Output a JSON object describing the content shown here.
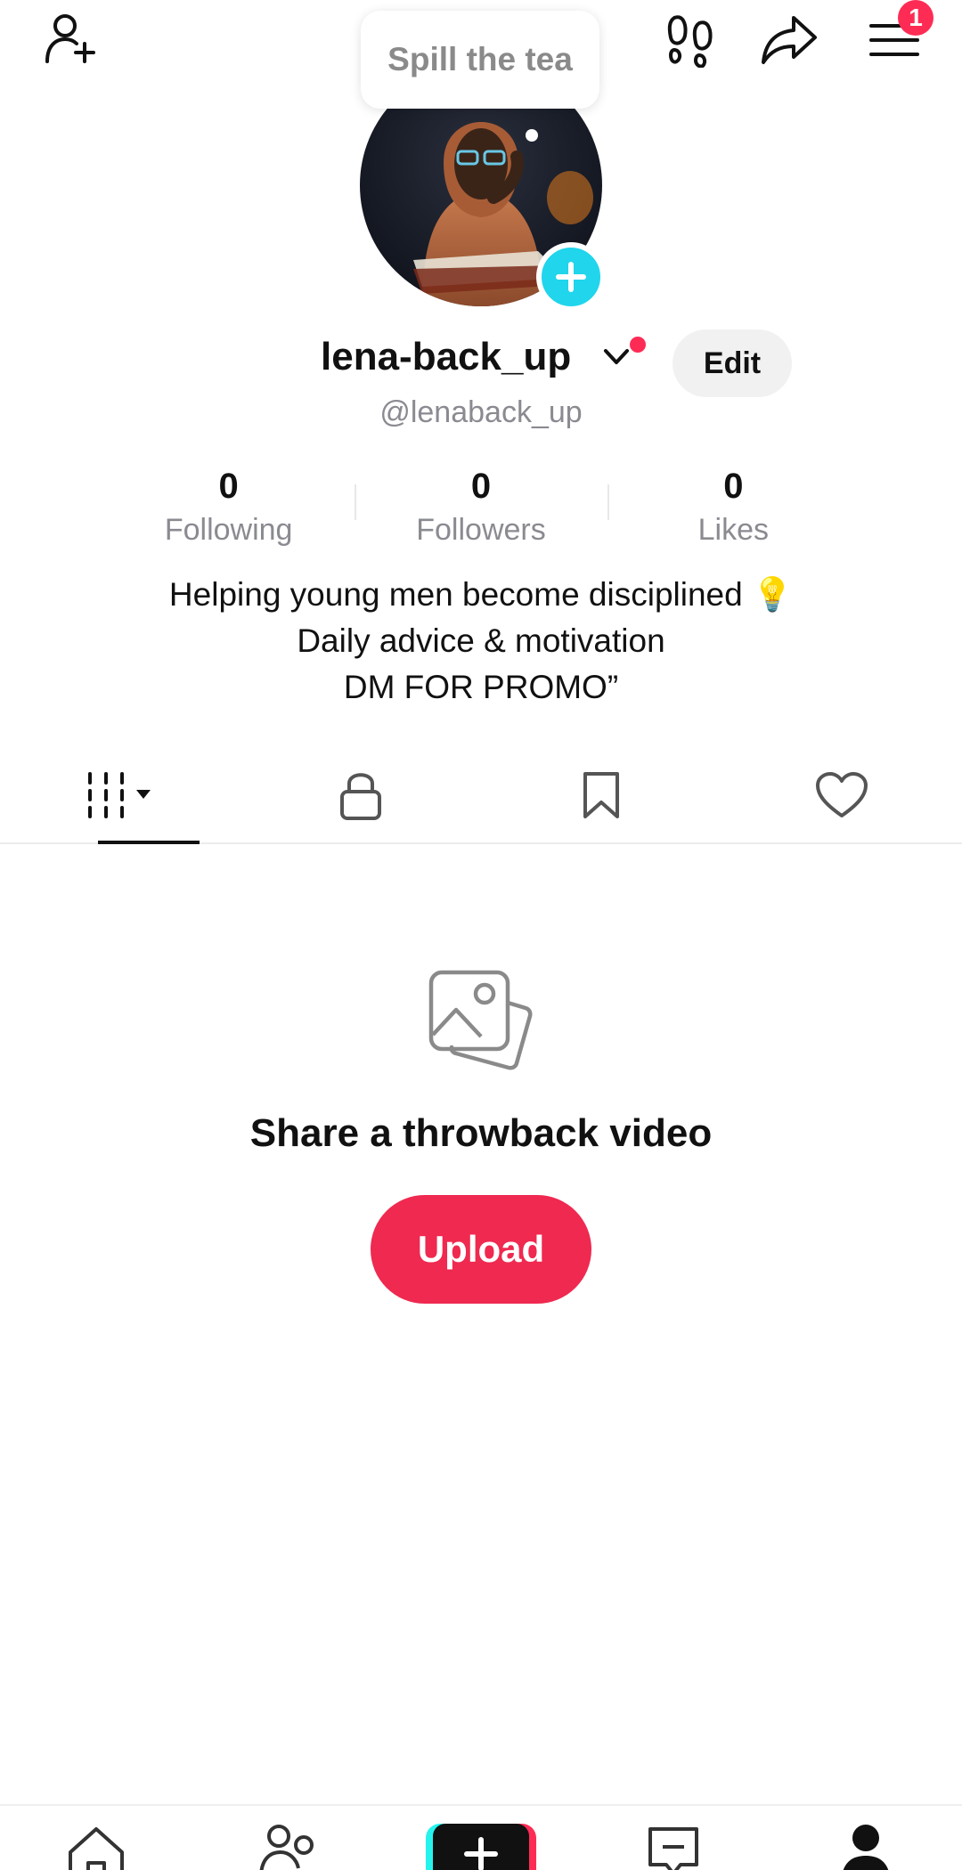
{
  "header": {
    "add_friend_icon": "person-plus-icon",
    "footprints_icon": "footprints-icon",
    "share_icon": "share-arrow-icon",
    "menu_icon": "hamburger-menu-icon",
    "menu_badge": "1"
  },
  "tooltip": {
    "text": "Spill the tea"
  },
  "profile": {
    "display_name": "lena-back_up",
    "handle": "@lenaback_up",
    "edit_label": "Edit",
    "avatar_add_icon": "plus-icon"
  },
  "stats": [
    {
      "value": "0",
      "label": "Following"
    },
    {
      "value": "0",
      "label": "Followers"
    },
    {
      "value": "0",
      "label": "Likes"
    }
  ],
  "bio": {
    "line1": "Helping young men become disciplined 💡",
    "line2": "Daily advice & motivation",
    "line3": "DM FOR PROMO”"
  },
  "tabs": [
    {
      "icon": "grid-videos-icon",
      "active": true
    },
    {
      "icon": "lock-icon",
      "active": false
    },
    {
      "icon": "bookmark-icon",
      "active": false
    },
    {
      "icon": "heart-icon",
      "active": false
    }
  ],
  "empty_state": {
    "icon": "photos-icon",
    "title": "Share a throwback video",
    "button_label": "Upload"
  },
  "bottom_nav": [
    {
      "icon": "home-icon"
    },
    {
      "icon": "friends-icon"
    },
    {
      "icon": "create-plus-icon"
    },
    {
      "icon": "inbox-icon"
    },
    {
      "icon": "profile-icon",
      "active": true
    }
  ],
  "colors": {
    "accent": "#fe2c55",
    "upload_button": "#ef2950",
    "avatar_add": "#20d5ec",
    "secondary_text": "#8a8b91"
  }
}
